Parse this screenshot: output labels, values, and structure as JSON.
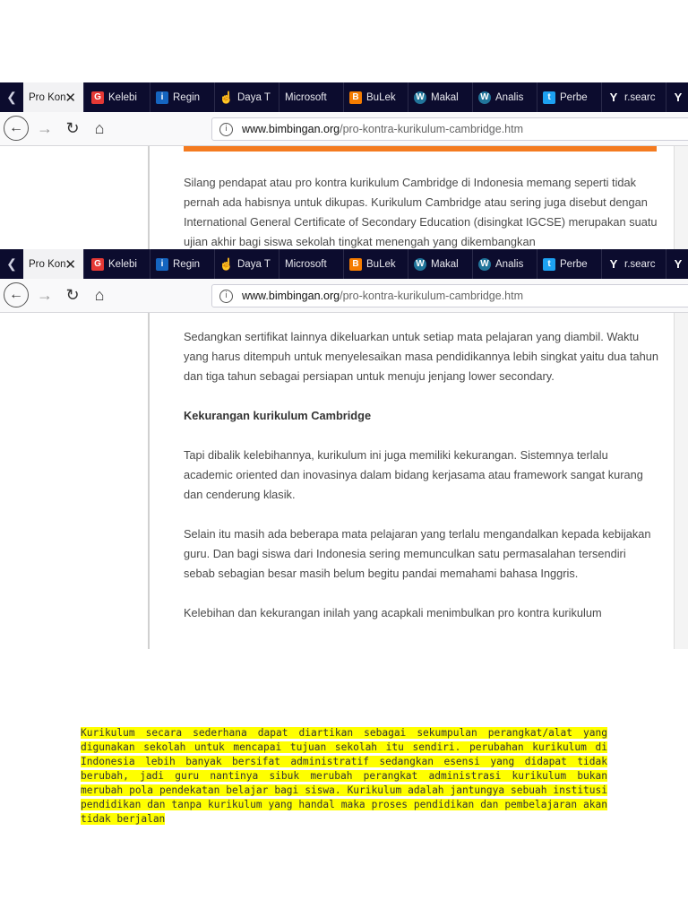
{
  "browser": {
    "tabs": [
      {
        "label": "Pro Kon",
        "icon": "page-icon",
        "active": true,
        "color": "#f2f2f4"
      },
      {
        "label": "Kelebi",
        "icon": "g-logo-icon",
        "active": false,
        "color": "#e53935"
      },
      {
        "label": "Regin",
        "icon": "info-icon",
        "active": false,
        "color": "#1565c0"
      },
      {
        "label": "Daya T",
        "icon": "hand-icon",
        "active": false,
        "color": "#e53935"
      },
      {
        "label": "Microsoft",
        "icon": "none",
        "active": false,
        "color": ""
      },
      {
        "label": "BuLek",
        "icon": "blogger-icon",
        "active": false,
        "color": "#f57c00"
      },
      {
        "label": "Makal",
        "icon": "wordpress-icon",
        "active": false,
        "color": "#21759b"
      },
      {
        "label": "Analis",
        "icon": "wordpress-icon",
        "active": false,
        "color": "#21759b"
      },
      {
        "label": "Perbe",
        "icon": "twitter-icon",
        "active": false,
        "color": "#1da1f2"
      },
      {
        "label": "r.searc",
        "icon": "yahoo-icon",
        "active": false,
        "color": "#6001d2"
      },
      {
        "label": "",
        "icon": "yahoo-icon",
        "active": false,
        "color": "#6001d2"
      }
    ],
    "url_domain": "www.bimbingan.org",
    "url_path": "/pro-kontra-kurikulum-cambridge.htm"
  },
  "screenshot1": {
    "paragraph": "Silang pendapat atau pro kontra kurikulum Cambridge di Indonesia memang seperti tidak pernah ada habisnya untuk dikupas. Kurikulum Cambridge atau sering juga disebut dengan International General Certificate of Secondary Education (disingkat IGCSE) merupakan suatu ujian akhir bagi siswa sekolah tingkat menengah yang dikembangkan"
  },
  "screenshot2": {
    "paragraph1": "Sedangkan sertifikat lainnya dikeluarkan untuk setiap mata pelajaran yang diambil. Waktu yang harus ditempuh untuk menyelesaikan masa pendidikannya lebih singkat yaitu dua tahun dan tiga tahun sebagai persiapan untuk menuju jenjang lower secondary.",
    "heading": "Kekurangan kurikulum Cambridge",
    "paragraph2": "Tapi dibalik kelebihannya, kurikulum ini juga memiliki kekurangan. Sistemnya terlalu academic oriented dan inovasinya dalam bidang kerjasama atau framework sangat kurang dan cenderung klasik.",
    "paragraph3": "Selain itu masih ada beberapa mata pelajaran yang terlalu mengandalkan kepada kebijakan guru. Dan bagi siswa dari Indonesia sering memunculkan satu permasalahan tersendiri sebab sebagian besar masih belum begitu pandai memahami bahasa Inggris.",
    "paragraph4": "Kelebihan dan kekurangan inilah yang acapkali menimbulkan pro kontra kurikulum"
  },
  "highlighted_text": "Kurikulum secara sederhana dapat diartikan sebagai sekumpulan perangkat/alat yang digunakan sekolah untuk mencapai tujuan sekolah itu sendiri. perubahan kurikulum di Indonesia lebih banyak bersifat administratif sedangkan esensi yang didapat tidak berubah, jadi guru nantinya sibuk merubah perangkat administrasi kurikulum bukan merubah pola pendekatan belajar bagi siswa. Kurikulum adalah jantungya sebuah institusi pendidikan dan tanpa kurikulum yang handal maka proses pendidikan dan pembelajaran akan tidak berjalan",
  "colors": {
    "tabbar": "#0c0c2e",
    "accent": "#f47b20",
    "highlight": "#ffff00"
  }
}
